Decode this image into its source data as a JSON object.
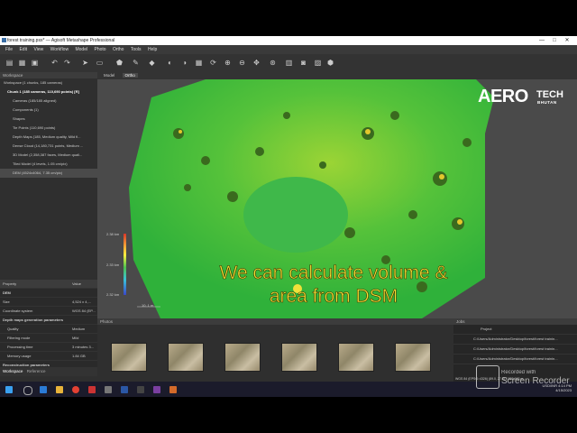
{
  "window": {
    "title": "forest training.psx* — Agisoft Metashape Professional",
    "controls": [
      "—",
      "□",
      "✕"
    ]
  },
  "menu": [
    "File",
    "Edit",
    "View",
    "Workflow",
    "Model",
    "Photo",
    "Ortho",
    "Tools",
    "Help"
  ],
  "workspace": {
    "header": "Workspace",
    "root": "Workspace (1 chunks, 185 cameras)",
    "items": [
      "Chunk 1 (185 cameras, 110,690 points) [R]",
      "Cameras (185/185 aligned)",
      "Components (1)",
      "Shapes",
      "Tie Points (110,690 points)",
      "Depth Maps (185, Medium quality, Mild fi...",
      "Dense Cloud (14,180,731 points, Medium ...",
      "3D Model (2,358,387 faces, Medium quali...",
      "Tiled Model (4 levels, 1.05 cm/pix)",
      "DEM (4524x4064, 7.35 cm/pix)"
    ]
  },
  "properties": {
    "col_property": "Property",
    "col_value": "Value",
    "section": "DEM",
    "rows": [
      {
        "k": "Size",
        "v": "4,524 x 4,..."
      },
      {
        "k": "Coordinate system",
        "v": "WGS 84 (EP..."
      }
    ],
    "section2": "Depth maps generation parameters",
    "rows2": [
      {
        "k": "Quality",
        "v": "Medium"
      },
      {
        "k": "Filtering mode",
        "v": "Mild"
      },
      {
        "k": "Processing time",
        "v": "3 minutes 3..."
      },
      {
        "k": "Memory usage",
        "v": "1.84 GB"
      }
    ],
    "section3": "Reconstruction parameters"
  },
  "bottom_tabs": [
    "Workspace",
    "Reference"
  ],
  "view_tabs": [
    "Model",
    "Ortho"
  ],
  "legend_labels": [
    "2.38 km",
    "2.33 km",
    "2.32 km"
  ],
  "scale_label": "10. 1 m",
  "photos": {
    "header": "Photos"
  },
  "console": {
    "header": "Jobs",
    "col": "Project",
    "rows": [
      "C:/Users/Administrator/Desktop/forest/forest trainin...",
      "C:/Users/Administrator/Desktop/forest/forest trainin...",
      "C:/Users/Administrator/Desktop/forest/forest trainin..."
    ]
  },
  "status": "WGS 84 (EPSG::4326) (89.0, 27.3) 2,550,663 m",
  "logo": {
    "main": "AERO",
    "tech": "TECH",
    "sub": "BHUTAN"
  },
  "caption": [
    "We can calculate volume &",
    "area from DSM"
  ],
  "watermark": [
    "Recorded with",
    "Screen Recorder"
  ],
  "taskbar": {
    "weather": "USD/INR",
    "time": "4:14 PM",
    "date": "4/15/2023"
  }
}
